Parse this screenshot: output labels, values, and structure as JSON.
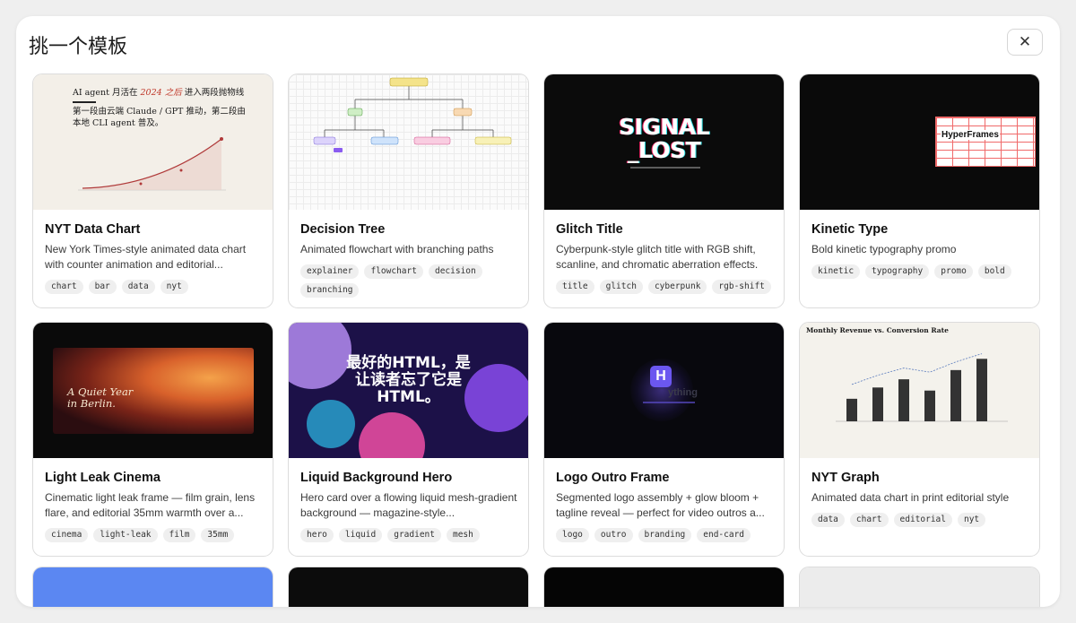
{
  "modal": {
    "title": "挑一个模板",
    "close_icon": "✕"
  },
  "cards": [
    {
      "title": "NYT Data Chart",
      "description": "New York Times-style animated data chart with counter animation and editorial...",
      "tags": [
        "chart",
        "bar",
        "data",
        "nyt"
      ],
      "thumb": {
        "heading_line1_a": "AI agent 月活在",
        "heading_line1_b": "2024 之后",
        "heading_line1_c": "进入两段抛物线",
        "heading_line2": "第一段由云端 Claude / GPT 推动，第二段由",
        "heading_line3": "本地 CLI agent 普及。"
      }
    },
    {
      "title": "Decision Tree",
      "description": "Animated flowchart with branching paths",
      "tags": [
        "explainer",
        "flowchart",
        "decision",
        "branching"
      ]
    },
    {
      "title": "Glitch Title",
      "description": "Cyberpunk-style glitch title with RGB shift, scanline, and chromatic aberration effects.",
      "tags": [
        "title",
        "glitch",
        "cyberpunk",
        "rgb-shift"
      ],
      "thumb": {
        "line1": "SIGNAL",
        "line2": "_LOST"
      }
    },
    {
      "title": "Kinetic Type",
      "description": "Bold kinetic typography promo",
      "tags": [
        "kinetic",
        "typography",
        "promo",
        "bold"
      ],
      "thumb": {
        "word": "HyperFrames"
      }
    },
    {
      "title": "Light Leak Cinema",
      "description": "Cinematic light leak frame — film grain, lens flare, and editorial 35mm warmth over a...",
      "tags": [
        "cinema",
        "light-leak",
        "film",
        "35mm"
      ],
      "thumb": {
        "line1": "A Quiet Year",
        "line2": "in Berlin."
      }
    },
    {
      "title": "Liquid Background Hero",
      "description": "Hero card over a flowing liquid mesh-gradient background — magazine-style...",
      "tags": [
        "hero",
        "liquid",
        "gradient",
        "mesh"
      ],
      "thumb": {
        "line1": "最好的HTML，是",
        "line2": "让读者忘了它是",
        "line3": "HTML。"
      }
    },
    {
      "title": "Logo Outro Frame",
      "description": "Segmented logo assembly + glow bloom + tagline reveal — perfect for video outros a...",
      "tags": [
        "logo",
        "outro",
        "branding",
        "end-card"
      ],
      "thumb": {
        "mark": "H",
        "ghost": "ything"
      }
    },
    {
      "title": "NYT Graph",
      "description": "Animated data chart in print editorial style",
      "tags": [
        "data",
        "chart",
        "editorial",
        "nyt"
      ],
      "thumb": {
        "heading": "Monthly Revenue vs. Conversion Rate"
      }
    }
  ],
  "stubs": [
    {
      "color": "#5b87f2"
    },
    {
      "color": "#0c0c0c"
    },
    {
      "color": "#050505"
    },
    {
      "color": "#ececec"
    }
  ],
  "chart_data": {
    "type": "bar",
    "title": "Monthly Revenue vs. Conversion Rate",
    "values": [
      22,
      33,
      41,
      30,
      50,
      61
    ],
    "line_values": [
      36,
      45,
      52,
      48,
      58,
      66
    ],
    "ylim": [
      0,
      70
    ]
  }
}
